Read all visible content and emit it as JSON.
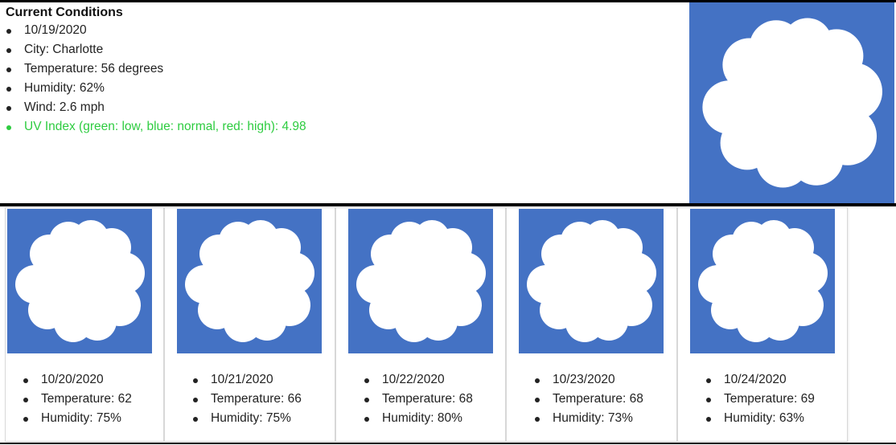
{
  "current": {
    "heading": "Current Conditions",
    "date": "10/19/2020",
    "city": "City: Charlotte",
    "temperature": "Temperature: 56 degrees",
    "humidity": "Humidity: 62%",
    "wind": "Wind: 2.6 mph",
    "uv": "UV Index (green: low, blue: normal, red: high): 4.98",
    "uv_color": "#2ecc40",
    "icon": "cloud-icon"
  },
  "colors": {
    "icon_background": "#4472c4",
    "cloud": "#ffffff"
  },
  "forecast": [
    {
      "date": "10/20/2020",
      "temperature": "Temperature: 62",
      "humidity": "Humidity: 75%",
      "icon": "cloud-icon"
    },
    {
      "date": "10/21/2020",
      "temperature": "Temperature: 66",
      "humidity": "Humidity: 75%",
      "icon": "cloud-icon"
    },
    {
      "date": "10/22/2020",
      "temperature": "Temperature: 68",
      "humidity": "Humidity: 80%",
      "icon": "cloud-icon"
    },
    {
      "date": "10/23/2020",
      "temperature": "Temperature: 68",
      "humidity": "Humidity: 73%",
      "icon": "cloud-icon"
    },
    {
      "date": "10/24/2020",
      "temperature": "Temperature: 69",
      "humidity": "Humidity: 63%",
      "icon": "cloud-icon"
    }
  ]
}
